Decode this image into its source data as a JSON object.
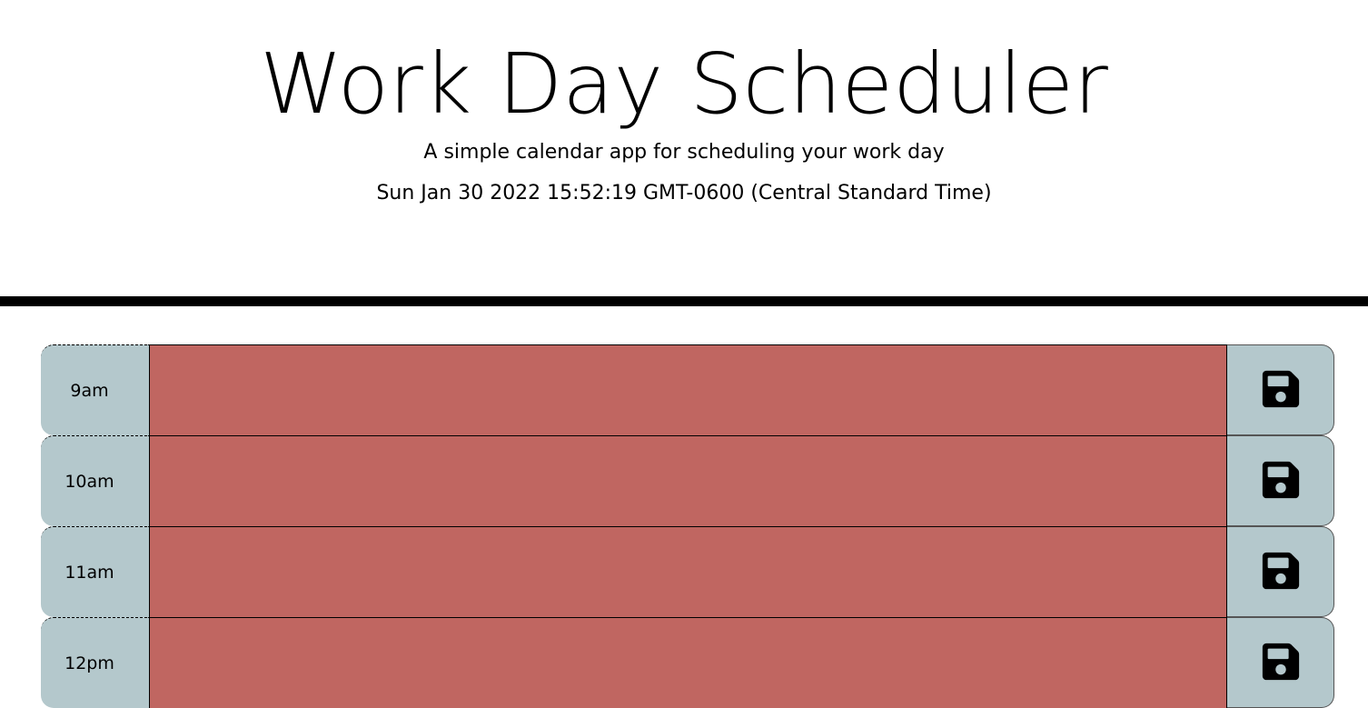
{
  "header": {
    "title": "Work Day Scheduler",
    "lead": "A simple calendar app for scheduling your work day",
    "current_day": "Sun Jan 30 2022 15:52:19 GMT-0600 (Central Standard Time)"
  },
  "colors": {
    "past": "#c06661",
    "hour_bg": "#b4c8cc"
  },
  "time_blocks": [
    {
      "hour": "9am",
      "text": "",
      "state": "past",
      "save_icon": "floppy-disk-icon"
    },
    {
      "hour": "10am",
      "text": "",
      "state": "past",
      "save_icon": "floppy-disk-icon"
    },
    {
      "hour": "11am",
      "text": "",
      "state": "past",
      "save_icon": "floppy-disk-icon"
    },
    {
      "hour": "12pm",
      "text": "",
      "state": "past",
      "save_icon": "floppy-disk-icon"
    }
  ]
}
